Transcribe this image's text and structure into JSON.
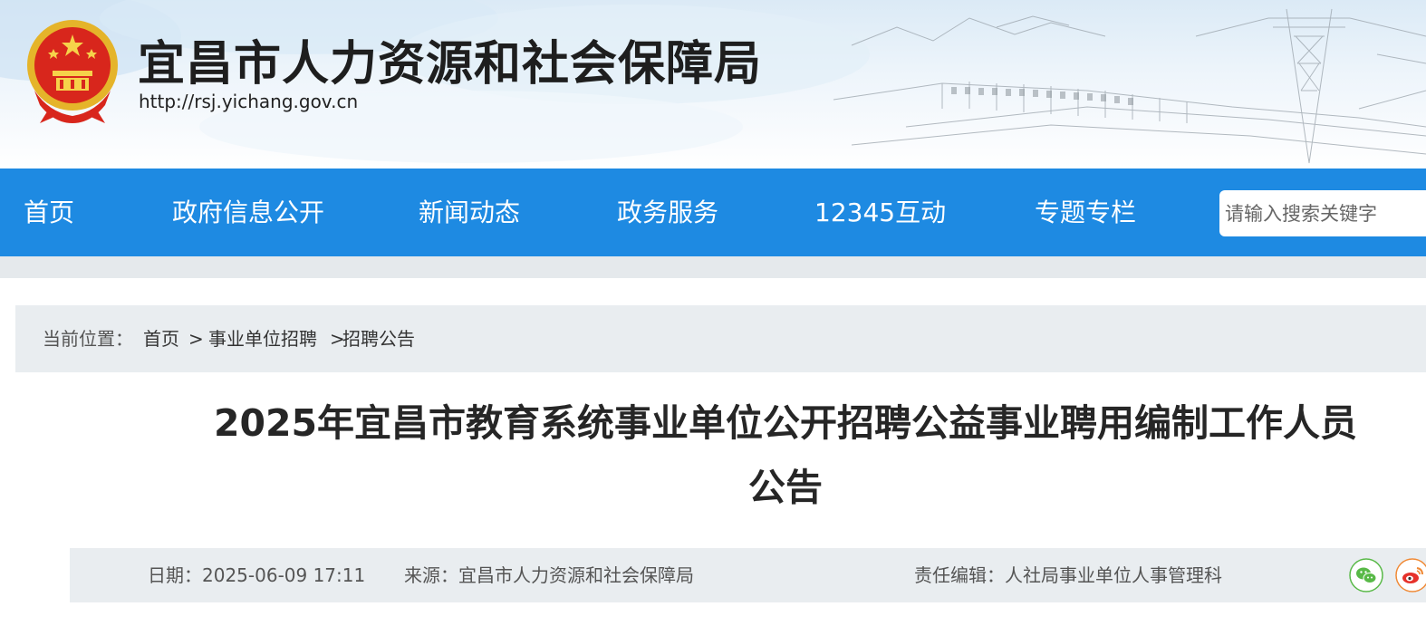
{
  "header": {
    "site_title": "宜昌市人力资源和社会保障局",
    "site_url": "http://rsj.yichang.gov.cn"
  },
  "nav": {
    "items": [
      {
        "label": "首页"
      },
      {
        "label": "政府信息公开"
      },
      {
        "label": "新闻动态"
      },
      {
        "label": "政务服务"
      },
      {
        "label": "12345互动"
      },
      {
        "label": "专题专栏"
      }
    ],
    "search_placeholder": "请输入搜索关键字"
  },
  "breadcrumb": {
    "prefix": "当前位置：",
    "home": "首页",
    "sep1": ">",
    "level1": "事业单位招聘",
    "sep2": ">",
    "level2": "招聘公告"
  },
  "article": {
    "title": "2025年宜昌市教育系统事业单位公开招聘公益事业聘用编制工作人员公告",
    "date": "日期：2025-06-09 17:11",
    "source": "来源：宜昌市人力资源和社会保障局",
    "editor": "责任编辑：人社局事业单位人事管理科"
  },
  "share": {
    "icons": [
      "wechat-icon",
      "weibo-icon"
    ]
  },
  "colors": {
    "nav_bg": "#1e8ae2",
    "strip_bg": "#e9edf0"
  }
}
